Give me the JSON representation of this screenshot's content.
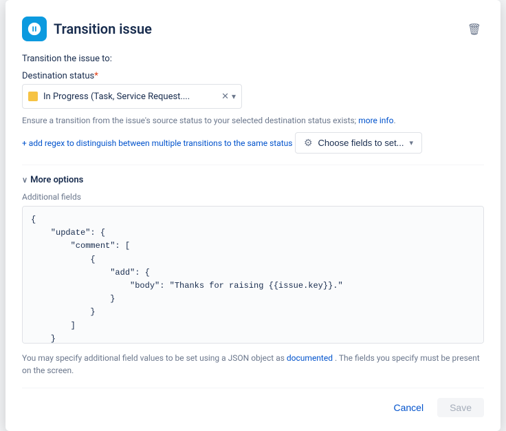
{
  "dialog": {
    "title": "Transition issue",
    "icon_alt": "transition-issue-icon"
  },
  "form": {
    "transition_label": "Transition the issue to:",
    "destination_label": "Destination status",
    "destination_value": "In Progress (Task, Service Request....",
    "status_color": "#f6c344",
    "info_text": "Ensure a transition from the issue's source status to your selected destination status exists;",
    "info_link_text": "more info",
    "regex_link": "+ add regex to distinguish between multiple transitions to the same status",
    "choose_fields_label": "Choose fields to set...",
    "more_options_label": "More options",
    "additional_fields_label": "Additional fields",
    "json_content": "{\n    \"update\": {\n        \"comment\": [\n            {\n                \"add\": {\n                    \"body\": \"Thanks for raising {{issue.key}}.\"\n                }\n            }\n        ]\n    }\n}",
    "bottom_info": "You may specify additional field values to be set using a JSON object as",
    "bottom_link": "documented",
    "bottom_info2": ". The fields you specify must be present on the screen."
  },
  "footer": {
    "cancel_label": "Cancel",
    "save_label": "Save"
  }
}
